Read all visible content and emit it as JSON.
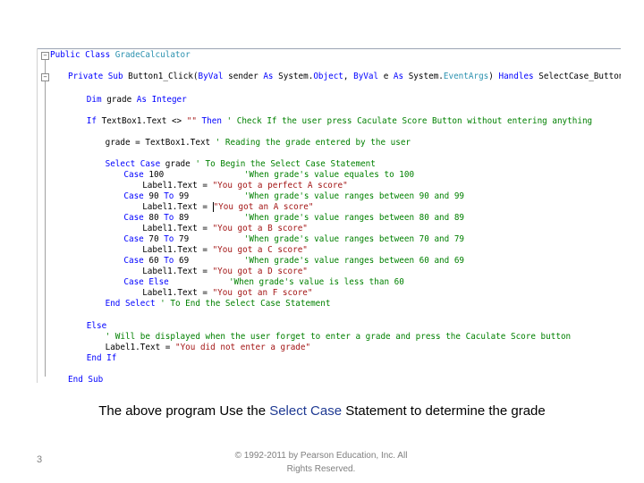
{
  "editor": {
    "lines": [
      {
        "indent": 0,
        "tokens": [
          {
            "t": "Public Class ",
            "c": "kw"
          },
          {
            "t": "GradeCalculator",
            "c": "cls"
          }
        ]
      },
      {
        "indent": 2,
        "tokens": [
          {
            "t": "Private Sub ",
            "c": "kw"
          },
          {
            "t": "Button1_Click(",
            "c": ""
          },
          {
            "t": "ByVal ",
            "c": "kw"
          },
          {
            "t": "sender ",
            "c": ""
          },
          {
            "t": "As ",
            "c": "kw"
          },
          {
            "t": "System.",
            "c": ""
          },
          {
            "t": "Object",
            "c": "kw"
          },
          {
            "t": ", ",
            "c": ""
          },
          {
            "t": "ByVal ",
            "c": "kw"
          },
          {
            "t": "e ",
            "c": ""
          },
          {
            "t": "As ",
            "c": "kw"
          },
          {
            "t": "System.",
            "c": ""
          },
          {
            "t": "EventArgs",
            "c": "cls"
          },
          {
            "t": ") ",
            "c": ""
          },
          {
            "t": "Handles ",
            "c": "kw"
          },
          {
            "t": "SelectCase_Button.Click",
            "c": ""
          }
        ]
      },
      {
        "indent": 4,
        "tokens": [
          {
            "t": "Dim ",
            "c": "kw"
          },
          {
            "t": "grade ",
            "c": ""
          },
          {
            "t": "As Integer",
            "c": "kw"
          }
        ]
      },
      {
        "indent": 4,
        "tokens": [
          {
            "t": "If ",
            "c": "kw"
          },
          {
            "t": "TextBox1.Text <> ",
            "c": ""
          },
          {
            "t": "\"\"",
            "c": "str"
          },
          {
            "t": " Then ",
            "c": "kw"
          },
          {
            "t": "' Check If the user press Caculate Score Button without entering anything",
            "c": "cm"
          }
        ]
      },
      {
        "indent": 6,
        "tokens": [
          {
            "t": "grade = TextBox1.Text ",
            "c": ""
          },
          {
            "t": "' Reading the grade entered by the user",
            "c": "cm"
          }
        ]
      },
      {
        "indent": 6,
        "tokens": [
          {
            "t": "Select Case ",
            "c": "kw"
          },
          {
            "t": "grade ",
            "c": ""
          },
          {
            "t": "' To Begin the Select Case Statement",
            "c": "cm"
          }
        ]
      },
      {
        "indent": 8,
        "tokens": [
          {
            "t": "Case ",
            "c": "kw"
          },
          {
            "t": "100                ",
            "c": ""
          },
          {
            "t": "'When grade's value equales to 100",
            "c": "cm"
          }
        ]
      },
      {
        "indent": 10,
        "tokens": [
          {
            "t": "Label1.Text = ",
            "c": ""
          },
          {
            "t": "\"You got a perfect A score\"",
            "c": "str"
          }
        ]
      },
      {
        "indent": 8,
        "tokens": [
          {
            "t": "Case ",
            "c": "kw"
          },
          {
            "t": "90 ",
            "c": ""
          },
          {
            "t": "To ",
            "c": "kw"
          },
          {
            "t": "99           ",
            "c": ""
          },
          {
            "t": "'When grade's value ranges between 90 and 99",
            "c": "cm"
          }
        ]
      },
      {
        "indent": 10,
        "cursor": true,
        "tokens": [
          {
            "t": "Label1.Text = ",
            "c": ""
          },
          {
            "t": "\"You got an A score\"",
            "c": "str"
          }
        ]
      },
      {
        "indent": 8,
        "tokens": [
          {
            "t": "Case ",
            "c": "kw"
          },
          {
            "t": "80 ",
            "c": ""
          },
          {
            "t": "To ",
            "c": "kw"
          },
          {
            "t": "89           ",
            "c": ""
          },
          {
            "t": "'When grade's value ranges between 80 and 89",
            "c": "cm"
          }
        ]
      },
      {
        "indent": 10,
        "tokens": [
          {
            "t": "Label1.Text = ",
            "c": ""
          },
          {
            "t": "\"You got a B score\"",
            "c": "str"
          }
        ]
      },
      {
        "indent": 8,
        "tokens": [
          {
            "t": "Case ",
            "c": "kw"
          },
          {
            "t": "70 ",
            "c": ""
          },
          {
            "t": "To ",
            "c": "kw"
          },
          {
            "t": "79           ",
            "c": ""
          },
          {
            "t": "'When grade's value ranges between 70 and 79",
            "c": "cm"
          }
        ]
      },
      {
        "indent": 10,
        "tokens": [
          {
            "t": "Label1.Text = ",
            "c": ""
          },
          {
            "t": "\"You got a C score\"",
            "c": "str"
          }
        ]
      },
      {
        "indent": 8,
        "tokens": [
          {
            "t": "Case ",
            "c": "kw"
          },
          {
            "t": "60 ",
            "c": ""
          },
          {
            "t": "To ",
            "c": "kw"
          },
          {
            "t": "69           ",
            "c": ""
          },
          {
            "t": "'When grade's value ranges between 60 and 69",
            "c": "cm"
          }
        ]
      },
      {
        "indent": 10,
        "tokens": [
          {
            "t": "Label1.Text = ",
            "c": ""
          },
          {
            "t": "\"You got a D score\"",
            "c": "str"
          }
        ]
      },
      {
        "indent": 8,
        "tokens": [
          {
            "t": "Case Else            ",
            "c": "kw"
          },
          {
            "t": "'When grade's value is less than 60",
            "c": "cm"
          }
        ]
      },
      {
        "indent": 10,
        "tokens": [
          {
            "t": "Label1.Text = ",
            "c": ""
          },
          {
            "t": "\"You got an F score\"",
            "c": "str"
          }
        ]
      },
      {
        "indent": 6,
        "tokens": [
          {
            "t": "End Select ",
            "c": "kw"
          },
          {
            "t": "' To End the Select Case Statement",
            "c": "cm"
          }
        ]
      },
      {
        "indent": 4,
        "tokens": [
          {
            "t": "Else",
            "c": "kw"
          }
        ]
      },
      {
        "indent": 6,
        "tokens": [
          {
            "t": "' Will be displayed when the user forget to enter a grade and press the Caculate Score button",
            "c": "cm"
          }
        ]
      },
      {
        "indent": 6,
        "tokens": [
          {
            "t": "Label1.Text = ",
            "c": ""
          },
          {
            "t": "\"You did not enter a grade\"",
            "c": "str"
          }
        ]
      },
      {
        "indent": 4,
        "tokens": [
          {
            "t": "End If",
            "c": "kw"
          }
        ]
      },
      {
        "indent": 2,
        "tokens": [
          {
            "t": "End Sub",
            "c": "kw"
          }
        ]
      }
    ]
  },
  "caption": {
    "before": "The above program Use the ",
    "highlight": "Select Case",
    "after": " Statement to determine the grade"
  },
  "footer": {
    "page_number": "3",
    "copyright_line1": "© 1992-2011 by Pearson Education, Inc. All",
    "copyright_line2": "Rights Reserved."
  }
}
